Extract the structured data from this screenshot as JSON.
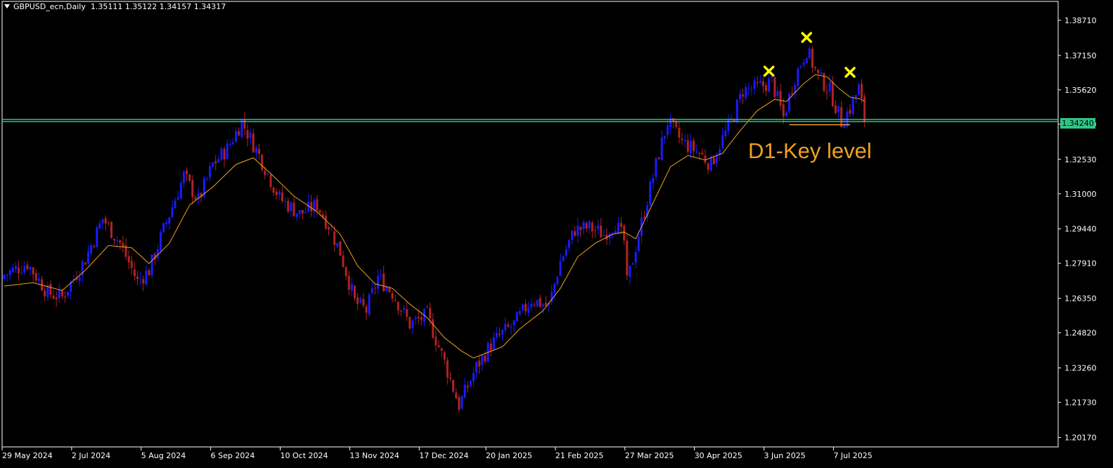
{
  "header": {
    "symbol_timeframe": "GBPUSD_ecn,Daily",
    "ohlc": "1.35111 1.35122 1.34157 1.34317"
  },
  "annotation": {
    "label": "D1-Key level"
  },
  "current_price_label": "1.34240",
  "colors": {
    "background": "#000000",
    "bull_candle": "#1a1aff",
    "bear_candle": "#b22222",
    "moving_average": "#f0a020",
    "key_level_line": "#2fc586",
    "annotation_text": "#f0a020",
    "markers": "#ffff00",
    "axis": "#ffffff"
  },
  "chart_data": {
    "type": "candlestick",
    "title": "",
    "symbol": "GBPUSD_ecn",
    "timeframe": "Daily",
    "ylim": [
      1.1975,
      1.3955
    ],
    "grid": false,
    "y_ticks": [
      "1.38710",
      "1.37150",
      "1.35620",
      "1.34090",
      "1.32530",
      "1.31000",
      "1.29440",
      "1.27910",
      "1.26350",
      "1.24820",
      "1.23260",
      "1.21730",
      "1.20170"
    ],
    "x_ticks": [
      {
        "label": "29 May 2024",
        "index": 0
      },
      {
        "label": "2 Jul 2024",
        "index": 24
      },
      {
        "label": "5 Aug 2024",
        "index": 48
      },
      {
        "label": "6 Sep 2024",
        "index": 72
      },
      {
        "label": "10 Oct 2024",
        "index": 96
      },
      {
        "label": "13 Nov 2024",
        "index": 120
      },
      {
        "label": "17 Dec 2024",
        "index": 144
      },
      {
        "label": "20 Jan 2025",
        "index": 167
      },
      {
        "label": "21 Feb 2025",
        "index": 191
      },
      {
        "label": "27 Mar 2025",
        "index": 215
      },
      {
        "label": "30 Apr 2025",
        "index": 239
      },
      {
        "label": "3 Jun 2025",
        "index": 263
      },
      {
        "label": "7 Jul 2025",
        "index": 287
      }
    ],
    "close_path": [
      [
        0,
        1.274
      ],
      [
        8,
        1.279
      ],
      [
        15,
        1.266
      ],
      [
        20,
        1.264
      ],
      [
        28,
        1.281
      ],
      [
        34,
        1.299
      ],
      [
        40,
        1.288
      ],
      [
        46,
        1.271
      ],
      [
        50,
        1.276
      ],
      [
        55,
        1.294
      ],
      [
        62,
        1.318
      ],
      [
        67,
        1.307
      ],
      [
        72,
        1.323
      ],
      [
        77,
        1.33
      ],
      [
        82,
        1.342
      ],
      [
        88,
        1.327
      ],
      [
        95,
        1.308
      ],
      [
        102,
        1.301
      ],
      [
        108,
        1.305
      ],
      [
        112,
        1.296
      ],
      [
        116,
        1.284
      ],
      [
        121,
        1.262
      ],
      [
        125,
        1.258
      ],
      [
        129,
        1.273
      ],
      [
        134,
        1.266
      ],
      [
        140,
        1.252
      ],
      [
        146,
        1.256
      ],
      [
        152,
        1.235
      ],
      [
        157,
        1.216
      ],
      [
        163,
        1.233
      ],
      [
        168,
        1.243
      ],
      [
        172,
        1.248
      ],
      [
        176,
        1.252
      ],
      [
        182,
        1.263
      ],
      [
        188,
        1.26
      ],
      [
        192,
        1.28
      ],
      [
        197,
        1.294
      ],
      [
        202,
        1.295
      ],
      [
        207,
        1.292
      ],
      [
        211,
        1.297
      ],
      [
        214,
        1.289
      ],
      [
        215,
        1.27
      ],
      [
        219,
        1.292
      ],
      [
        226,
        1.328
      ],
      [
        229,
        1.342
      ],
      [
        234,
        1.333
      ],
      [
        240,
        1.328
      ],
      [
        244,
        1.323
      ],
      [
        247,
        1.332
      ],
      [
        251,
        1.342
      ],
      [
        255,
        1.356
      ],
      [
        260,
        1.357
      ],
      [
        265,
        1.36
      ],
      [
        269,
        1.344
      ],
      [
        273,
        1.362
      ],
      [
        277,
        1.374
      ],
      [
        281,
        1.362
      ],
      [
        285,
        1.356
      ],
      [
        289,
        1.342
      ],
      [
        292,
        1.348
      ],
      [
        295,
        1.357
      ],
      [
        297,
        1.3432
      ]
    ],
    "moving_average_path": [
      [
        0,
        1.269
      ],
      [
        10,
        1.2705
      ],
      [
        20,
        1.267
      ],
      [
        28,
        1.276
      ],
      [
        36,
        1.287
      ],
      [
        44,
        1.286
      ],
      [
        50,
        1.279
      ],
      [
        57,
        1.288
      ],
      [
        64,
        1.305
      ],
      [
        72,
        1.313
      ],
      [
        80,
        1.323
      ],
      [
        86,
        1.326
      ],
      [
        92,
        1.319
      ],
      [
        100,
        1.309
      ],
      [
        108,
        1.302
      ],
      [
        116,
        1.292
      ],
      [
        122,
        1.278
      ],
      [
        128,
        1.27
      ],
      [
        134,
        1.268
      ],
      [
        140,
        1.261
      ],
      [
        146,
        1.255
      ],
      [
        152,
        1.246
      ],
      [
        158,
        1.24
      ],
      [
        162,
        1.237
      ],
      [
        166,
        1.239
      ],
      [
        172,
        1.242
      ],
      [
        178,
        1.25
      ],
      [
        186,
        1.258
      ],
      [
        192,
        1.268
      ],
      [
        198,
        1.282
      ],
      [
        204,
        1.288
      ],
      [
        210,
        1.292
      ],
      [
        214,
        1.293
      ],
      [
        218,
        1.29
      ],
      [
        224,
        1.306
      ],
      [
        230,
        1.322
      ],
      [
        236,
        1.327
      ],
      [
        242,
        1.325
      ],
      [
        248,
        1.328
      ],
      [
        254,
        1.338
      ],
      [
        260,
        1.347
      ],
      [
        266,
        1.352
      ],
      [
        270,
        1.351
      ],
      [
        276,
        1.359
      ],
      [
        280,
        1.363
      ],
      [
        284,
        1.362
      ],
      [
        288,
        1.357
      ],
      [
        292,
        1.353
      ],
      [
        296,
        1.352
      ],
      [
        297,
        1.351
      ]
    ],
    "key_level": 1.3424,
    "key_level_segment": {
      "from_index": 271,
      "to_index": 292,
      "price": 1.3407
    },
    "markers": [
      {
        "index": 264,
        "price": 1.3645
      },
      {
        "index": 277,
        "price": 1.3795
      },
      {
        "index": 292,
        "price": 1.364
      }
    ]
  }
}
